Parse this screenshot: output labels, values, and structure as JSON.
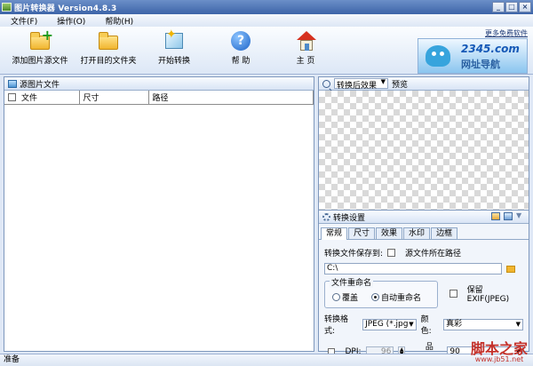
{
  "window": {
    "title": "图片转换器 Version4.8.3",
    "minimize_symbol": "_",
    "maximize_symbol": "□",
    "close_symbol": "×"
  },
  "menu": {
    "file": "文件(F)",
    "operate": "操作(O)",
    "help": "帮助(H)"
  },
  "toolbar": {
    "add_images": "添加图片源文件",
    "open_folder": "打开目的文件夹",
    "start_convert": "开始转换",
    "help": "帮 助",
    "home": "主 页",
    "ad_link": "更多免费软件",
    "ad_brand": "2345.com",
    "ad_slogan": "网址导航"
  },
  "left_panel": {
    "title": "源图片文件",
    "columns": [
      "文件",
      "尺寸",
      "路径"
    ]
  },
  "preview": {
    "effect_select": "转换后效果",
    "preview_label": "预览"
  },
  "settings": {
    "title": "转换设置",
    "tabs": [
      "常规",
      "尺寸",
      "效果",
      "水印",
      "边框"
    ],
    "save_to_label": "转换文件保存到:",
    "source_path_checkbox": "源文件所在路径",
    "path_value": "C:\\",
    "rename_group": "文件重命名",
    "overwrite": "覆盖",
    "auto_rename": "自动重命名",
    "keep_exif": "保留EXIF(JPEG)",
    "format_label": "转换格式:",
    "format_value": "JPEG (*.jpg",
    "color_label": "颜色:",
    "color_value": "真彩",
    "dpi_label": "DPI:",
    "dpi_value": "96",
    "quality_label": "品质:",
    "quality_value": "90"
  },
  "status": {
    "text": "准备"
  },
  "watermark": {
    "title": "脚本之家",
    "url": "www.jb51.net"
  }
}
